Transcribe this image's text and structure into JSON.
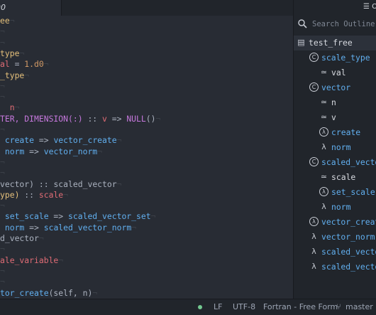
{
  "tab": {
    "title": "90"
  },
  "editor": {
    "lines": [
      {
        "parts": [
          {
            "t": "ee",
            "c": "tp"
          },
          {
            "t": "¬",
            "c": "ws"
          }
        ]
      },
      {
        "parts": [
          {
            "t": "¬",
            "c": "ws"
          }
        ]
      },
      {
        "parts": [
          {
            "t": "¬",
            "c": "ws"
          }
        ]
      },
      {
        "parts": [
          {
            "t": "type",
            "c": "tp"
          },
          {
            "t": "¬",
            "c": "ws"
          }
        ]
      },
      {
        "parts": [
          {
            "t": "al",
            "c": "var"
          },
          {
            "t": " = ",
            "c": "pl"
          },
          {
            "t": "1.d0",
            "c": "num"
          },
          {
            "t": "¬",
            "c": "ws"
          }
        ]
      },
      {
        "parts": [
          {
            "t": "_type",
            "c": "tp"
          },
          {
            "t": "¬",
            "c": "ws"
          }
        ]
      },
      {
        "parts": [
          {
            "t": "¬",
            "c": "ws"
          }
        ]
      },
      {
        "parts": [
          {
            "t": "¬",
            "c": "ws"
          }
        ]
      },
      {
        "parts": [
          {
            "t": "  n",
            "c": "var"
          },
          {
            "t": "¬",
            "c": "ws"
          }
        ]
      },
      {
        "parts": [
          {
            "t": "TER, DIMENSION(:)",
            "c": "kw"
          },
          {
            "t": " :: ",
            "c": "pl"
          },
          {
            "t": "v",
            "c": "var"
          },
          {
            "t": " => ",
            "c": "pl"
          },
          {
            "t": "NULL",
            "c": "kw"
          },
          {
            "t": "()",
            "c": "pl"
          },
          {
            "t": "¬",
            "c": "ws"
          }
        ]
      },
      {
        "parts": [
          {
            "t": "¬",
            "c": "ws"
          }
        ]
      },
      {
        "parts": [
          {
            "t": " create",
            "c": "fn"
          },
          {
            "t": " => ",
            "c": "pl"
          },
          {
            "t": "vector_create",
            "c": "fn"
          },
          {
            "t": "¬",
            "c": "ws"
          }
        ]
      },
      {
        "parts": [
          {
            "t": " norm",
            "c": "fn"
          },
          {
            "t": " => ",
            "c": "pl"
          },
          {
            "t": "vector_norm",
            "c": "fn"
          },
          {
            "t": "¬",
            "c": "ws"
          }
        ]
      },
      {
        "parts": [
          {
            "t": "¬",
            "c": "ws"
          }
        ]
      },
      {
        "parts": [
          {
            "t": "¬",
            "c": "ws"
          }
        ]
      },
      {
        "parts": [
          {
            "t": "vector)",
            "c": "pl"
          },
          {
            "t": " :: ",
            "c": "pl"
          },
          {
            "t": "scaled_vector",
            "c": "pl"
          },
          {
            "t": "¬",
            "c": "ws"
          }
        ]
      },
      {
        "parts": [
          {
            "t": "ype)",
            "c": "tp"
          },
          {
            "t": " :: ",
            "c": "pl"
          },
          {
            "t": "scale",
            "c": "var"
          },
          {
            "t": "¬",
            "c": "ws"
          }
        ]
      },
      {
        "parts": [
          {
            "t": "¬",
            "c": "ws"
          }
        ]
      },
      {
        "parts": [
          {
            "t": " set_scale",
            "c": "fn"
          },
          {
            "t": " => ",
            "c": "pl"
          },
          {
            "t": "scaled_vector_set",
            "c": "fn"
          },
          {
            "t": "¬",
            "c": "ws"
          }
        ]
      },
      {
        "parts": [
          {
            "t": " norm",
            "c": "fn"
          },
          {
            "t": " => ",
            "c": "pl"
          },
          {
            "t": "scaled_vector_norm",
            "c": "fn"
          },
          {
            "t": "¬",
            "c": "ws"
          }
        ]
      },
      {
        "parts": [
          {
            "t": "d_vector",
            "c": "pl"
          },
          {
            "t": "¬",
            "c": "ws"
          }
        ]
      },
      {
        "parts": [
          {
            "t": "¬",
            "c": "ws"
          }
        ]
      },
      {
        "parts": [
          {
            "t": "ale_variable",
            "c": "var"
          },
          {
            "t": "¬",
            "c": "ws"
          }
        ]
      },
      {
        "parts": [
          {
            "t": "¬",
            "c": "ws"
          }
        ]
      },
      {
        "parts": [
          {
            "t": "¬",
            "c": "ws"
          }
        ]
      },
      {
        "parts": [
          {
            "t": "tor_create",
            "c": "fn"
          },
          {
            "t": "(self, n)",
            "c": "pl"
          },
          {
            "t": "¬",
            "c": "ws"
          }
        ]
      }
    ]
  },
  "outline": {
    "header": "Ou",
    "search_placeholder": "Search Outline",
    "items": [
      {
        "label": "test_free",
        "icon": "module-icon",
        "glyph": "▤",
        "indent": 0,
        "color": "c-plain",
        "selected": true
      },
      {
        "label": "scale_type",
        "icon": "class-icon",
        "glyph": "C",
        "indent": 1,
        "color": "c-blue"
      },
      {
        "label": "val",
        "icon": "variable-icon",
        "glyph": "≃",
        "indent": 2,
        "color": "c-plain"
      },
      {
        "label": "vector",
        "icon": "class-icon",
        "glyph": "C",
        "indent": 1,
        "color": "c-blue"
      },
      {
        "label": "n",
        "icon": "variable-icon",
        "glyph": "≃",
        "indent": 2,
        "color": "c-plain"
      },
      {
        "label": "v",
        "icon": "variable-icon",
        "glyph": "≃",
        "indent": 2,
        "color": "c-plain"
      },
      {
        "label": "create",
        "icon": "method-icon",
        "glyph": "λ",
        "indent": 2,
        "color": "c-blue",
        "circle": true
      },
      {
        "label": "norm",
        "icon": "function-icon",
        "glyph": "λ",
        "indent": 2,
        "color": "c-blue"
      },
      {
        "label": "scaled_vector",
        "icon": "class-icon",
        "glyph": "C",
        "indent": 1,
        "color": "c-blue"
      },
      {
        "label": "scale",
        "icon": "variable-icon",
        "glyph": "≃",
        "indent": 2,
        "color": "c-plain"
      },
      {
        "label": "set_scale",
        "icon": "method-icon",
        "glyph": "λ",
        "indent": 2,
        "color": "c-blue",
        "circle": true
      },
      {
        "label": "norm",
        "icon": "function-icon",
        "glyph": "λ",
        "indent": 2,
        "color": "c-blue"
      },
      {
        "label": "vector_create",
        "icon": "method-icon",
        "glyph": "λ",
        "indent": 1,
        "color": "c-blue",
        "circle": true
      },
      {
        "label": "vector_norm",
        "icon": "function-icon",
        "glyph": "λ",
        "indent": 1,
        "color": "c-blue"
      },
      {
        "label": "scaled_vector",
        "icon": "function-icon",
        "glyph": "λ",
        "indent": 1,
        "color": "c-blue"
      },
      {
        "label": "scaled_vector",
        "icon": "function-icon",
        "glyph": "λ",
        "indent": 1,
        "color": "c-blue"
      }
    ]
  },
  "status": {
    "line_ending": "LF",
    "encoding": "UTF-8",
    "grammar": "Fortran - Free Form",
    "branch": "master"
  }
}
